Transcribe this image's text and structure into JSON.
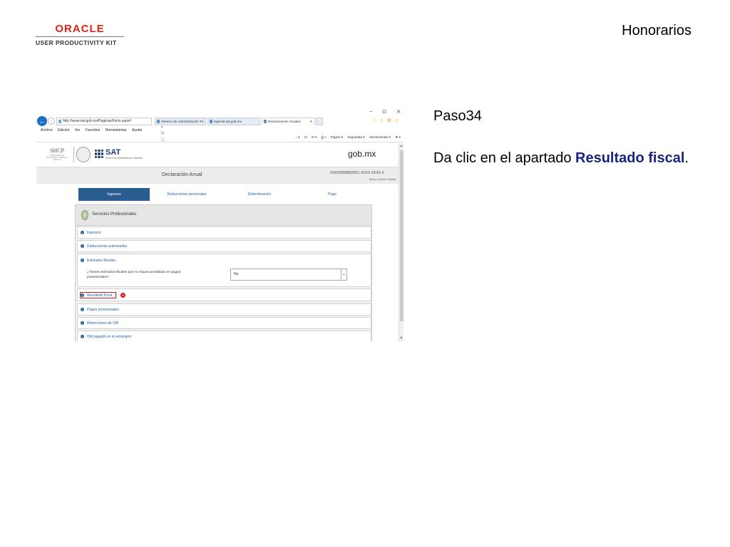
{
  "logo": {
    "brand": "ORACLE",
    "product": "USER PRODUCTIVITY KIT"
  },
  "slide_title": "Honorarios",
  "step": {
    "title": "Paso34",
    "instruction_prefix": "Da clic en el apartado ",
    "instruction_emph": "Resultado fiscal",
    "instruction_suffix": "."
  },
  "browser": {
    "window_controls": [
      "–",
      "⊡",
      "✕"
    ],
    "address": "http://www.sat.gob.mx/Paginas/Inicio.aspx#",
    "address_icons": "⌕ ▾ ⚐ ↻",
    "tabs": [
      {
        "label": "Servicio de Administración Tri...",
        "active": false
      },
      {
        "label": "loginsat.sat.gob.mx",
        "active": false
      },
      {
        "label": "Declaraciones Anuales",
        "active": true,
        "close": "X"
      }
    ],
    "star_icons": "⌂☆⚙☺",
    "menu": [
      "Archivo",
      "Edición",
      "Ver",
      "Favoritos",
      "Herramientas",
      "Ayuda"
    ],
    "command_bar": [
      "⌂ ▾",
      "⊡",
      "✉ ▾",
      "⎙ ▾",
      "Página ▾",
      "Seguridad ▾",
      "Herramientas ▾",
      "⚙ ▾"
    ]
  },
  "site": {
    "shcp": "SHCP",
    "shcp_sub": "SECRETARÍA DE HACIENDA Y CRÉDITO PÚBLICO",
    "sat": "SAT",
    "sat_sub": "Servicio de Administración Tributaria",
    "gobmx": "gob.mx",
    "declaration_title": "Declaración Anual",
    "rfc": "XXXX000000X00  |  XXXX XXXX X",
    "links": "Inicio | Cerrar Sesión"
  },
  "main_tabs": [
    {
      "label": "Ingresos",
      "active": true
    },
    {
      "label": "Deducciones personales",
      "active": false
    },
    {
      "label": "Determinación",
      "active": false
    },
    {
      "label": "Pago",
      "active": false
    }
  ],
  "panel": {
    "title": "Servicios Profesionales",
    "person_icon": "i",
    "sections": [
      {
        "label": "Ingresos"
      },
      {
        "label": "Deducciones autorizadas"
      },
      {
        "label": "Estímulos fiscales"
      },
      {
        "label": "Resultado fiscal"
      },
      {
        "label": "Pagos provisionales"
      },
      {
        "label": "Retenciones de ISR"
      },
      {
        "label": "ISR pagado en el extranjero"
      }
    ],
    "question": "¿Tienes estímulos fiscales que no hayas acreditado en pagos provisionales?",
    "select_value": "No",
    "select_arrow": "⌄",
    "badge": "2",
    "bullet": "+"
  }
}
